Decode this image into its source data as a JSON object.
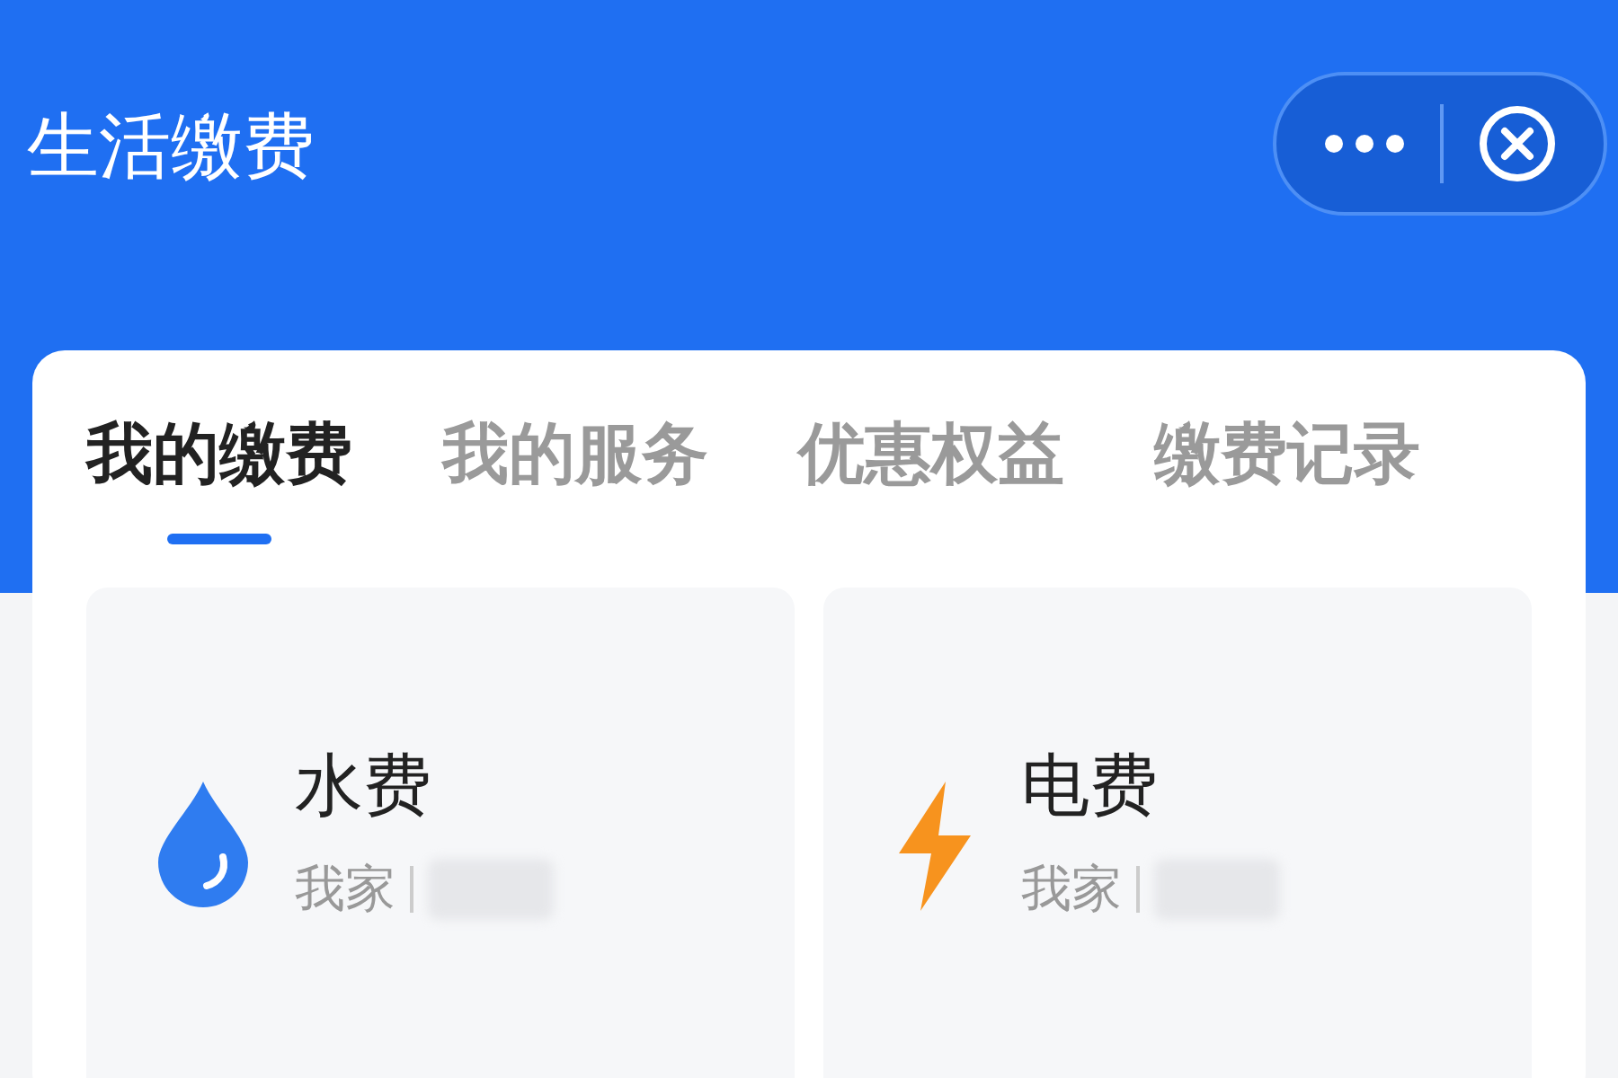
{
  "header": {
    "title": "生活缴费"
  },
  "tabs": [
    {
      "label": "我的缴费",
      "selected": true
    },
    {
      "label": "我的服务",
      "selected": false
    },
    {
      "label": "优惠权益",
      "selected": false
    },
    {
      "label": "缴费记录",
      "selected": false
    }
  ],
  "bills": [
    {
      "kind": "water",
      "name": "水费",
      "account": "我家"
    },
    {
      "kind": "electricity",
      "name": "电费",
      "account": "我家"
    }
  ]
}
